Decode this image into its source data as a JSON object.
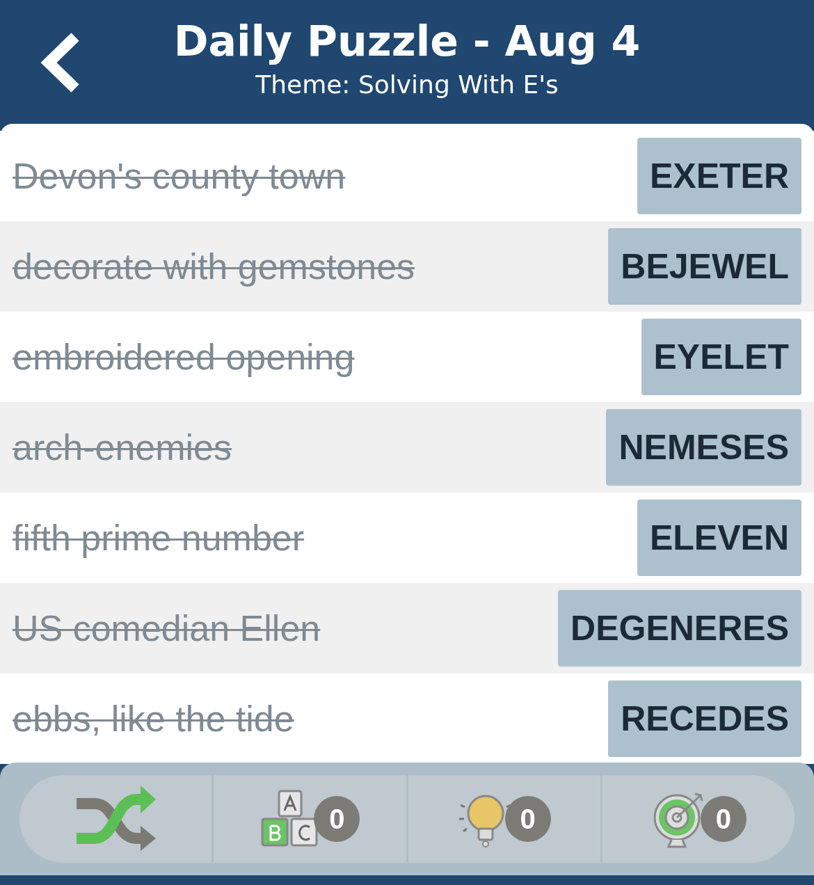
{
  "header": {
    "title": "Daily Puzzle - Aug 4",
    "subtitle": "Theme: Solving With E's"
  },
  "clues": [
    {
      "clue": "Devon's county town",
      "answer": "EXETER",
      "solved": true
    },
    {
      "clue": "decorate with gemstones",
      "answer": "BEJEWEL",
      "solved": true
    },
    {
      "clue": "embroidered opening",
      "answer": "EYELET",
      "solved": true
    },
    {
      "clue": "arch-enemies",
      "answer": "NEMESES",
      "solved": true
    },
    {
      "clue": "fifth prime number",
      "answer": "ELEVEN",
      "solved": true
    },
    {
      "clue": "US comedian Ellen",
      "answer": "DEGENERES",
      "solved": true
    },
    {
      "clue": "ebbs, like the tide",
      "answer": "RECEDES",
      "solved": true
    }
  ],
  "toolbar": [
    {
      "kind": "shuffle"
    },
    {
      "kind": "letters",
      "count": "0"
    },
    {
      "kind": "hint",
      "count": "0"
    },
    {
      "kind": "target",
      "count": "0"
    }
  ]
}
